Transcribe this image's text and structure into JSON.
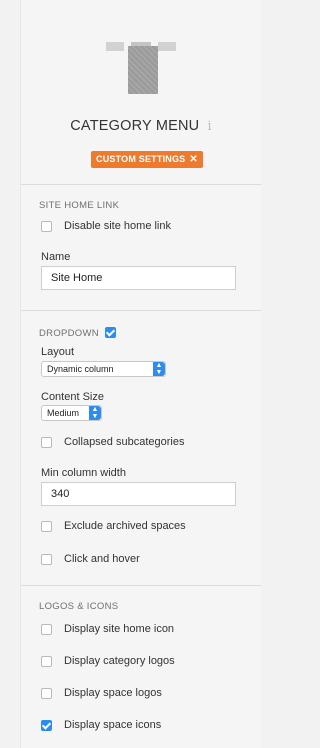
{
  "header": {
    "icon": "category-menu-icon",
    "title": "CATEGORY MENU",
    "info_icon": "i",
    "badge": {
      "label": "CUSTOM SETTINGS",
      "close": "✕"
    }
  },
  "site_home_link": {
    "heading": "SITE HOME LINK",
    "disable_label": "Disable site home link",
    "disable_checked": false,
    "name_label": "Name",
    "name_value": "Site Home"
  },
  "dropdown": {
    "heading": "DROPDOWN",
    "enabled": true,
    "layout_label": "Layout",
    "layout_value": "Dynamic column",
    "content_size_label": "Content Size",
    "content_size_value": "Medium",
    "collapsed_label": "Collapsed subcategories",
    "collapsed_checked": false,
    "min_width_label": "Min column width",
    "min_width_value": "340",
    "exclude_archived_label": "Exclude archived spaces",
    "exclude_archived_checked": false,
    "click_hover_label": "Click and hover",
    "click_hover_checked": false
  },
  "logos_icons": {
    "heading": "LOGOS & ICONS",
    "items": [
      {
        "label": "Display site home icon",
        "checked": false
      },
      {
        "label": "Display category logos",
        "checked": false
      },
      {
        "label": "Display space logos",
        "checked": false
      },
      {
        "label": "Display space icons",
        "checked": true
      }
    ]
  },
  "colors": {
    "accent": "#2d8cf0",
    "badge": "#ee7a2d"
  }
}
